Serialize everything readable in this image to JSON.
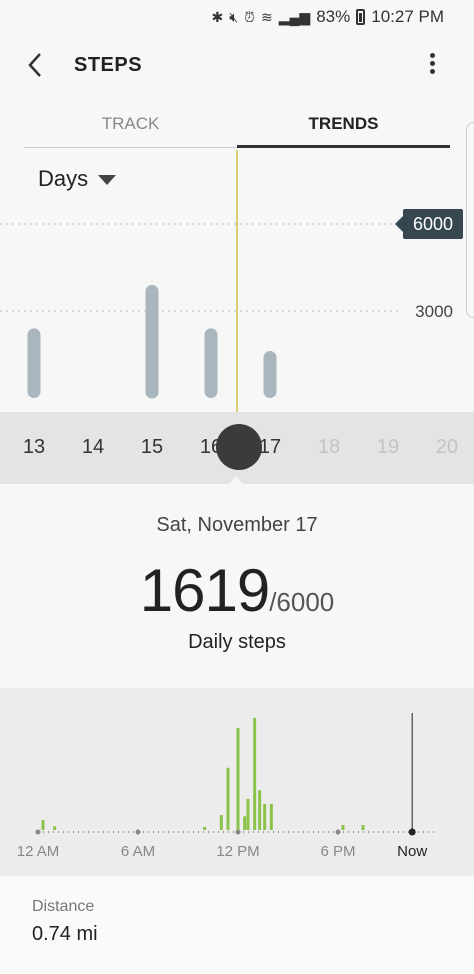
{
  "status_bar": {
    "icons": [
      "bluetooth-icon",
      "mute-icon",
      "alarm-icon",
      "wifi-icon",
      "signal-icon",
      "battery-icon"
    ],
    "battery": "83%",
    "time": "10:27 PM"
  },
  "app_bar": {
    "title": "STEPS",
    "back_icon": "back-arrow-icon",
    "menu_icon": "more-vert-icon"
  },
  "tabs": [
    {
      "label": "TRACK",
      "active": false
    },
    {
      "label": "TRENDS",
      "active": true
    }
  ],
  "period_selector": {
    "value": "Days"
  },
  "chart_data": [
    {
      "type": "bar",
      "categories": [
        "13",
        "14",
        "15",
        "16",
        "17",
        "18",
        "19",
        "20"
      ],
      "values": [
        2400,
        200,
        3900,
        2400,
        1619,
        null,
        null,
        null
      ],
      "goal": 6000,
      "gridlines": [
        3000,
        6000
      ],
      "goal_label": "6000",
      "mid_label": "3000",
      "selected": "17",
      "bar_color": "#a9b6be"
    },
    {
      "type": "bar",
      "x_labels": [
        "12 AM",
        "6 AM",
        "12 PM",
        "6 PM",
        "Now"
      ],
      "hours": [
        0.3,
        1,
        10,
        11,
        11.4,
        12,
        12.4,
        12.6,
        13,
        13.3,
        13.6,
        14,
        18.3,
        19.5
      ],
      "values": [
        80,
        30,
        25,
        120,
        500,
        820,
        110,
        250,
        900,
        320,
        210,
        210,
        40,
        40
      ],
      "bar_color": "#8bc34a"
    }
  ],
  "day_strip": {
    "days": [
      {
        "label": "13",
        "future": false
      },
      {
        "label": "14",
        "future": false
      },
      {
        "label": "15",
        "future": false
      },
      {
        "label": "16",
        "future": false
      },
      {
        "label": "17",
        "future": false
      },
      {
        "label": "18",
        "future": true
      },
      {
        "label": "19",
        "future": true
      },
      {
        "label": "20",
        "future": true
      }
    ]
  },
  "summary": {
    "date": "Sat, November 17",
    "steps": "1619",
    "goal": "/6000",
    "label": "Daily steps"
  },
  "distance": {
    "label": "Distance",
    "value": "0.74 mi"
  },
  "colors": {
    "accent_line": "#d4c14a",
    "dark": "#37474f",
    "green": "#8bc34a"
  }
}
